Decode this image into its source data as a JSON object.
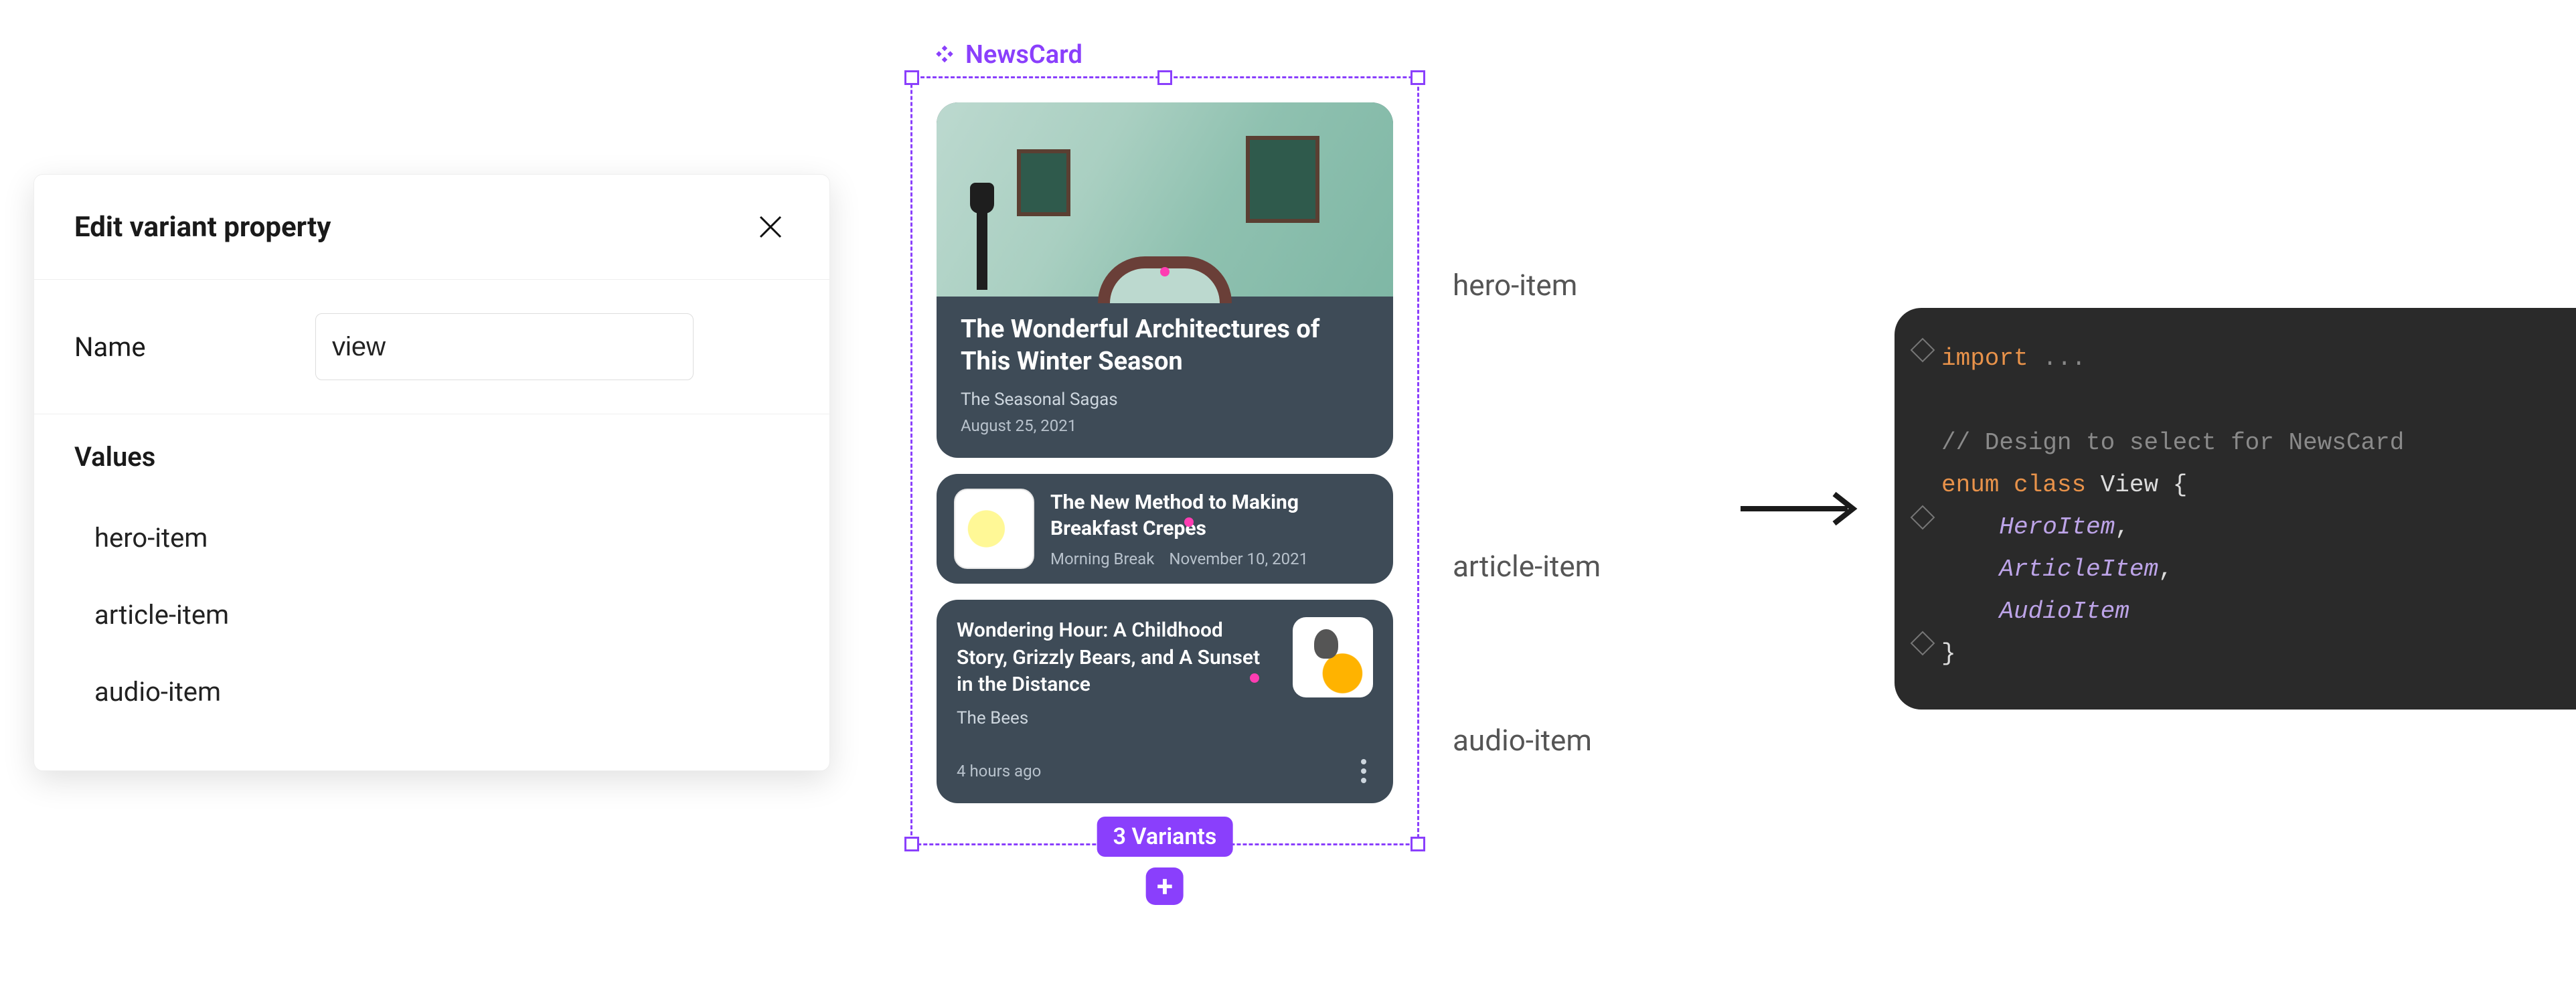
{
  "panel": {
    "title": "Edit variant property",
    "name_label": "Name",
    "name_value": "view",
    "values_heading": "Values",
    "values": [
      "hero-item",
      "article-item",
      "audio-item"
    ]
  },
  "component": {
    "name": "NewsCard",
    "variant_count_label": "3 Variants",
    "hero": {
      "title": "The Wonderful Architectures of This Winter Season",
      "source": "The Seasonal Sagas",
      "date": "August 25, 2021"
    },
    "article": {
      "title": "The New Method to Making Breakfast Crepes",
      "source": "Morning Break",
      "date": "November 10, 2021"
    },
    "audio": {
      "title": "Wondering Hour: A Childhood Story, Grizzly Bears, and A Sunset in the Distance",
      "source": "The Bees",
      "ago": "4 hours ago"
    }
  },
  "variant_labels": [
    "hero-item",
    "article-item",
    "audio-item"
  ],
  "code": {
    "import_kw": "import",
    "import_rest": " ...",
    "comment": "// Design to select for NewsCard",
    "enum_kw": "enum",
    "class_kw": "class",
    "enum_name": " View ",
    "brace_open": "{",
    "v1": "HeroItem",
    "v2": "ArticleItem",
    "v3": "AudioItem",
    "comma": ",",
    "brace_close": "}"
  }
}
